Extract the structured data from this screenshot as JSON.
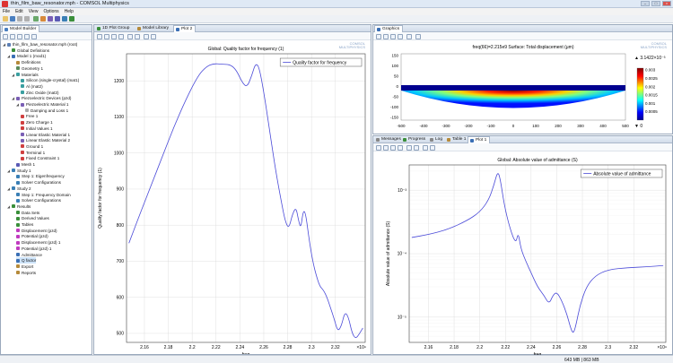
{
  "window": {
    "title": "thin_film_baw_resonator.mph - COMSOL Multiphysics"
  },
  "menu": [
    "File",
    "Edit",
    "View",
    "Options",
    "Help"
  ],
  "model_builder": {
    "tab_label": "Model Builder",
    "tree": [
      {
        "label": "thin_film_baw_resonator.mph (root)",
        "level": 0,
        "expanded": true,
        "color": "#5b7fb5"
      },
      {
        "label": "Global Definitions",
        "level": 1,
        "expanded": false,
        "color": "#3a8f3a"
      },
      {
        "label": "Model 1 (mod1)",
        "level": 1,
        "expanded": true,
        "color": "#3a6fb5"
      },
      {
        "label": "Definitions",
        "level": 2,
        "expanded": false,
        "color": "#b58a3a"
      },
      {
        "label": "Geometry 1",
        "level": 2,
        "expanded": false,
        "color": "#5a8a5a"
      },
      {
        "label": "Materials",
        "level": 2,
        "expanded": true,
        "color": "#3a9fa0"
      },
      {
        "label": "Silicon (single-crystal) (mat1)",
        "level": 3,
        "expanded": false,
        "color": "#3a9fa0"
      },
      {
        "label": "Al (mat2)",
        "level": 3,
        "expanded": false,
        "color": "#3a9fa0"
      },
      {
        "label": "Zinc Oxide (mat3)",
        "level": 3,
        "expanded": false,
        "color": "#3a9fa0"
      },
      {
        "label": "Piezoelectric Devices (pzd)",
        "level": 2,
        "expanded": true,
        "color": "#7a5fb5"
      },
      {
        "label": "Piezoelectric Material 1",
        "level": 3,
        "expanded": true,
        "color": "#7a5fb5"
      },
      {
        "label": "Damping and Loss 1",
        "level": 4,
        "expanded": false,
        "color": "#aaaaaa"
      },
      {
        "label": "Free 1",
        "level": 3,
        "expanded": false,
        "color": "#d04040"
      },
      {
        "label": "Zero Charge 1",
        "level": 3,
        "expanded": false,
        "color": "#d04040"
      },
      {
        "label": "Initial Values 1",
        "level": 3,
        "expanded": false,
        "color": "#d04040"
      },
      {
        "label": "Linear Elastic Material 1",
        "level": 3,
        "expanded": false,
        "color": "#7a5fb5"
      },
      {
        "label": "Linear Elastic Material 2",
        "level": 3,
        "expanded": false,
        "color": "#7a5fb5"
      },
      {
        "label": "Ground 1",
        "level": 3,
        "expanded": false,
        "color": "#d04040"
      },
      {
        "label": "Terminal 1",
        "level": 3,
        "expanded": false,
        "color": "#d04040"
      },
      {
        "label": "Fixed Constraint 1",
        "level": 3,
        "expanded": false,
        "color": "#d04040"
      },
      {
        "label": "Mesh 1",
        "level": 2,
        "expanded": false,
        "color": "#5a5ab5"
      },
      {
        "label": "Study 1",
        "level": 1,
        "expanded": true,
        "color": "#3a7fb5"
      },
      {
        "label": "Step 1: Eigenfrequency",
        "level": 2,
        "expanded": false,
        "color": "#3a7fb5"
      },
      {
        "label": "Solver Configurations",
        "level": 2,
        "expanded": false,
        "color": "#3a7fb5"
      },
      {
        "label": "Study 2",
        "level": 1,
        "expanded": true,
        "color": "#3a7fb5"
      },
      {
        "label": "Step 1: Frequency Domain",
        "level": 2,
        "expanded": false,
        "color": "#3a7fb5"
      },
      {
        "label": "Solver Configurations",
        "level": 2,
        "expanded": false,
        "color": "#3a7fb5"
      },
      {
        "label": "Results",
        "level": 1,
        "expanded": true,
        "color": "#3a8f3a"
      },
      {
        "label": "Data Sets",
        "level": 2,
        "expanded": false,
        "color": "#3a8f3a"
      },
      {
        "label": "Derived Values",
        "level": 2,
        "expanded": false,
        "color": "#3a8f3a"
      },
      {
        "label": "Tables",
        "level": 2,
        "expanded": false,
        "color": "#3a8f3a"
      },
      {
        "label": "Displacement (pzd)",
        "level": 2,
        "expanded": false,
        "color": "#c03ac0"
      },
      {
        "label": "Potential (pzd)",
        "level": 2,
        "expanded": false,
        "color": "#c03ac0"
      },
      {
        "label": "Displacement (pzd) 1",
        "level": 2,
        "expanded": false,
        "color": "#c03ac0"
      },
      {
        "label": "Potential (pzd) 1",
        "level": 2,
        "expanded": false,
        "color": "#c03ac0"
      },
      {
        "label": "Admittance",
        "level": 2,
        "expanded": false,
        "color": "#3a6fb5"
      },
      {
        "label": "Q factor",
        "level": 2,
        "expanded": false,
        "color": "#3a6fb5",
        "selected": true
      },
      {
        "label": "Export",
        "level": 2,
        "expanded": false,
        "color": "#b58a3a"
      },
      {
        "label": "Reports",
        "level": 2,
        "expanded": false,
        "color": "#b58a3a"
      }
    ]
  },
  "middle": {
    "tabs": [
      "1D Plot Group",
      "Model Library",
      "Plot 2"
    ],
    "active_tab": "Plot 2"
  },
  "graphics": {
    "tab_label": "Graphics",
    "title": "freq(66)=2.215e9    Surface: Total displacement (μm)",
    "colorbar_max": "▲ 3.1422×10⁻³",
    "colorbar_min": "▼ 0",
    "colorbar_ticks": [
      "0.003",
      "0.0025",
      "0.002",
      "0.0015",
      "0.001",
      "0.0005"
    ],
    "y_ticks": [
      "150",
      "100",
      "50",
      "0",
      "-50",
      "-100",
      "-150"
    ],
    "x_ticks": [
      "-500",
      "-400",
      "-300",
      "-200",
      "-100",
      "0",
      "100",
      "200",
      "300",
      "400",
      "500"
    ]
  },
  "bottom_right": {
    "tabs": [
      "Messages",
      "Progress",
      "Log",
      "Table 1",
      "Plot 1"
    ],
    "active_tab": "Plot 1"
  },
  "logo_text": [
    "COMSOL",
    "MULTIPHYSICS"
  ],
  "status": {
    "memory": "643 MB | 863 MB"
  },
  "chart_data": [
    {
      "type": "line",
      "title": "Global: Quality factor for frequency (1)",
      "xlabel": "freq",
      "ylabel": "Quality factor for frequency (1)",
      "x_exponent_label": "×10⁹",
      "xlim": [
        2.145,
        2.345
      ],
      "ylim": [
        475,
        1275
      ],
      "xticks": [
        2.16,
        2.18,
        2.2,
        2.22,
        2.24,
        2.26,
        2.28,
        2.3,
        2.32
      ],
      "xtick_labels": [
        "2.16",
        "2.18",
        "2.2",
        "2.22",
        "2.24",
        "2.26",
        "2.28",
        "2.3",
        "2.32"
      ],
      "yticks": [
        500,
        600,
        700,
        800,
        900,
        1000,
        1100,
        1200
      ],
      "ytick_labels": [
        "500",
        "600",
        "700",
        "800",
        "900",
        "1000",
        "1100",
        "1200"
      ],
      "legend": "top-right",
      "series": [
        {
          "name": "Quality factor for frequency",
          "color": "#4a4ad8",
          "x": [
            2.147,
            2.155,
            2.165,
            2.175,
            2.185,
            2.195,
            2.205,
            2.212,
            2.218,
            2.225,
            2.232,
            2.237,
            2.242,
            2.246,
            2.25,
            2.253,
            2.256,
            2.26,
            2.265,
            2.27,
            2.275,
            2.278,
            2.281,
            2.284,
            2.287,
            2.289,
            2.291,
            2.293,
            2.295,
            2.298,
            2.301,
            2.304,
            2.307,
            2.31,
            2.313,
            2.316,
            2.319,
            2.322,
            2.325,
            2.328,
            2.331,
            2.334,
            2.337,
            2.34,
            2.343
          ],
          "y": [
            750,
            820,
            905,
            990,
            1075,
            1150,
            1215,
            1240,
            1248,
            1246,
            1245,
            1230,
            1195,
            1182,
            1215,
            1248,
            1240,
            1170,
            1060,
            950,
            860,
            810,
            790,
            830,
            850,
            815,
            790,
            840,
            835,
            760,
            700,
            660,
            630,
            620,
            600,
            570,
            540,
            505,
            520,
            560,
            545,
            500,
            485,
            498,
            515
          ]
        }
      ]
    },
    {
      "type": "line",
      "title": "Global: Absolute value of admittance (S)",
      "xlabel": "freq",
      "ylabel": "Absolute value of admittance (S)",
      "x_exponent_label": "×10⁹",
      "y_scale": "log",
      "xlim": [
        2.145,
        2.345
      ],
      "ylim": [
        4e-06,
        0.0025
      ],
      "xticks": [
        2.16,
        2.18,
        2.2,
        2.22,
        2.24,
        2.26,
        2.28,
        2.3,
        2.32
      ],
      "xtick_labels": [
        "2.16",
        "2.18",
        "2.2",
        "2.22",
        "2.24",
        "2.26",
        "2.28",
        "2.3",
        "2.32"
      ],
      "yticks": [
        1e-05,
        0.0001,
        0.001
      ],
      "ytick_labels": [
        "10⁻⁵",
        "10⁻⁴",
        "10⁻³"
      ],
      "legend": "top-right",
      "series": [
        {
          "name": "Absolute value of admittance",
          "color": "#4a4ad8",
          "x": [
            2.147,
            2.16,
            2.175,
            2.19,
            2.2,
            2.207,
            2.211,
            2.214,
            2.216,
            2.219,
            2.223,
            2.228,
            2.23,
            2.232,
            2.236,
            2.24,
            2.245,
            2.25,
            2.254,
            2.257,
            2.26,
            2.264,
            2.268,
            2.271,
            2.273,
            2.275,
            2.278,
            2.283,
            2.29,
            2.3,
            2.315,
            2.33,
            2.343
          ],
          "y": [
            0.00018,
            0.0002,
            0.00024,
            0.00033,
            0.00045,
            0.0007,
            0.0012,
            0.002,
            0.0015,
            0.0006,
            0.00027,
            0.00014,
            0.00022,
            0.00012,
            7.5e-05,
            5e-05,
            3e-05,
            2.2e-05,
            1.6e-05,
            2.2e-05,
            2.5e-05,
            1.8e-05,
            1.1e-05,
            6.5e-06,
            5.5e-06,
            7.5e-06,
            1.5e-05,
            3e-05,
            4.5e-05,
            5.6e-05,
            6e-05,
            6.2e-05,
            6.5e-05
          ]
        }
      ]
    }
  ]
}
